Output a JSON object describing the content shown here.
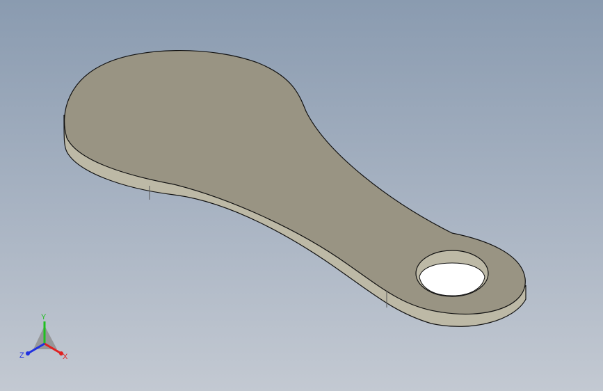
{
  "viewport": {
    "background_top": "#8a9bb0",
    "background_bottom": "#c3c9d2"
  },
  "model": {
    "face_color": "#999483",
    "side_color": "#bdb9a6",
    "edge_color": "#111111"
  },
  "triad": {
    "x_label": "X",
    "y_label": "Y",
    "z_label": "Z",
    "x_color": "#e02020",
    "y_color": "#20c020",
    "z_color": "#2030e0"
  }
}
